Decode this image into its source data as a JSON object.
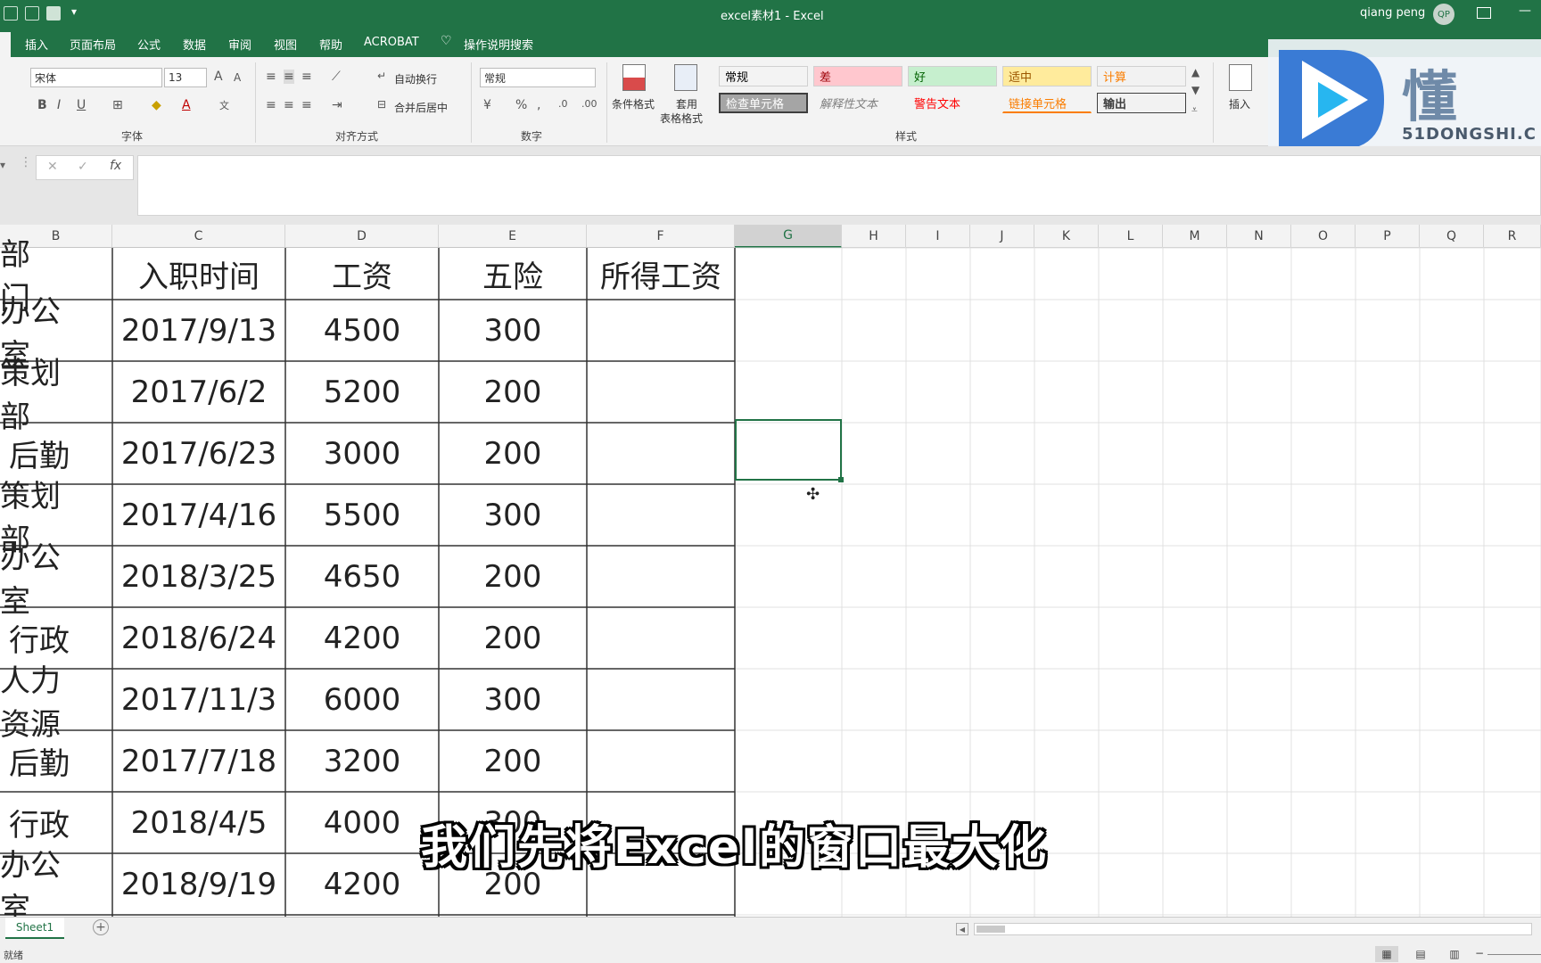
{
  "window": {
    "title": "excel素材1  -  Excel",
    "user": "qiang peng",
    "avatar_initials": "QP"
  },
  "menu": {
    "tabs": [
      "插入",
      "页面布局",
      "公式",
      "数据",
      "审阅",
      "视图",
      "帮助",
      "ACROBAT"
    ],
    "tell_me": "操作说明搜索"
  },
  "ribbon": {
    "font_name": "宋体",
    "font_size": "13",
    "wrap_text": "自动换行",
    "merge_center": "合并后居中",
    "number_format": "常规",
    "conditional_format": "条件格式",
    "format_table_1": "套用",
    "format_table_2": "表格格式",
    "insert": "插入",
    "groups": {
      "font": "字体",
      "align": "对齐方式",
      "number": "数字",
      "styles": "样式"
    },
    "styles": [
      {
        "label": "常规",
        "bg": "#ffffff",
        "fg": "#222222"
      },
      {
        "label": "差",
        "bg": "#ffc7ce",
        "fg": "#9c0006"
      },
      {
        "label": "好",
        "bg": "#c6efce",
        "fg": "#006100"
      },
      {
        "label": "适中",
        "bg": "#ffeb9c",
        "fg": "#9c5700"
      },
      {
        "label": "计算",
        "bg": "#f2f2f2",
        "fg": "#fa7d00"
      },
      {
        "label": "检查单元格",
        "bg": "#a5a5a5",
        "fg": "#ffffff"
      },
      {
        "label": "解释性文本",
        "bg": "#ffffff",
        "fg": "#7f7f7f"
      },
      {
        "label": "警告文本",
        "bg": "#ffffff",
        "fg": "#ff0000"
      },
      {
        "label": "链接单元格",
        "bg": "#ffffff",
        "fg": "#fa7d00"
      },
      {
        "label": "输出",
        "bg": "#f2f2f2",
        "fg": "#3f3f3f"
      }
    ]
  },
  "watermark": {
    "logo_text": "懂",
    "site": "51DONGSHI.C"
  },
  "columns": [
    "B",
    "C",
    "D",
    "E",
    "F",
    "G",
    "H",
    "I",
    "J",
    "K",
    "L",
    "M",
    "N",
    "O",
    "P",
    "Q",
    "R"
  ],
  "table": {
    "headers": [
      "部  门",
      "入职时间",
      "工资",
      "五险",
      "所得工资"
    ],
    "rows": [
      [
        "办公室",
        "2017/9/13",
        "4500",
        "300",
        ""
      ],
      [
        "策划部",
        "2017/6/2",
        "5200",
        "200",
        ""
      ],
      [
        "后勤",
        "2017/6/23",
        "3000",
        "200",
        ""
      ],
      [
        "策划部",
        "2017/4/16",
        "5500",
        "300",
        ""
      ],
      [
        "办公室",
        "2018/3/25",
        "4650",
        "200",
        ""
      ],
      [
        "行政",
        "2018/6/24",
        "4200",
        "200",
        ""
      ],
      [
        "人力资源",
        "2017/11/3",
        "6000",
        "300",
        ""
      ],
      [
        "后勤",
        "2017/7/18",
        "3200",
        "200",
        ""
      ],
      [
        "行政",
        "2018/4/5",
        "4000",
        "300",
        ""
      ],
      [
        "办公室",
        "2018/9/19",
        "4200",
        "200",
        ""
      ]
    ]
  },
  "subtitle": "我们先将Excel的窗口最大化",
  "sheet": {
    "tab": "Sheet1"
  },
  "status": {
    "text": "就绪"
  },
  "colors": {
    "excel_green": "#217346",
    "selection": "#217346",
    "grid_line": "#e1e1e1"
  }
}
